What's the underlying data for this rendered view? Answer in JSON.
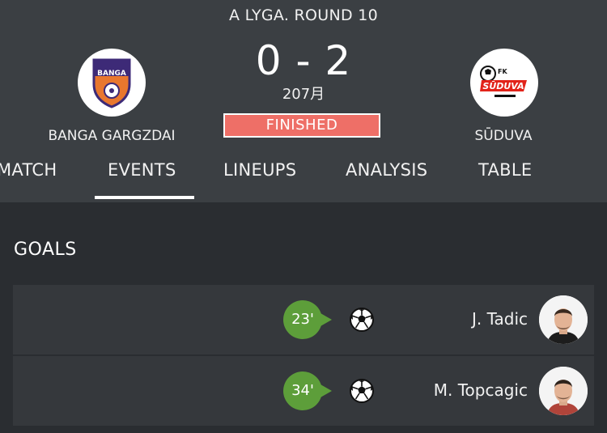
{
  "match": {
    "round_title": "A LYGA. ROUND 10",
    "score": "0 - 2",
    "minute": "207月",
    "status": "FINISHED",
    "status_color": "#ee6f67",
    "home_team": {
      "name": "BANGA GARGZDAI",
      "logo_text": "BANGA",
      "logo_icon": "banga-crest-icon"
    },
    "away_team": {
      "name": "SŪDUVA",
      "logo_text": "SŪDUVA",
      "logo_prefix": "FK",
      "logo_icon": "suduva-crest-icon"
    }
  },
  "tabs": [
    {
      "label": "MATCH",
      "active": false
    },
    {
      "label": "EVENTS",
      "active": true
    },
    {
      "label": "LINEUPS",
      "active": false
    },
    {
      "label": "ANALYSIS",
      "active": false
    },
    {
      "label": "TABLE",
      "active": false
    }
  ],
  "goals": {
    "title": "GOALS",
    "items": [
      {
        "minute": "23'",
        "player": "J. Tadic",
        "icon": "soccer-ball-icon"
      },
      {
        "minute": "34'",
        "player": "M. Topcagic",
        "icon": "soccer-ball-icon"
      }
    ]
  },
  "colors": {
    "header_bg": "#3b3f43",
    "page_bg": "#2a2d31",
    "minute_badge": "#5d9e3a"
  }
}
